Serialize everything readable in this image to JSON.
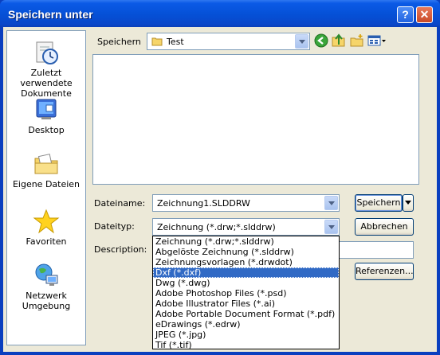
{
  "window": {
    "title": "Speichern unter"
  },
  "places": [
    {
      "label": "Zuletzt verwendete Dokumente",
      "icon": "recent-documents-icon"
    },
    {
      "label": "Desktop",
      "icon": "desktop-icon"
    },
    {
      "label": "Eigene Dateien",
      "icon": "my-documents-icon"
    },
    {
      "label": "Favoriten",
      "icon": "favorites-star-icon"
    },
    {
      "label": "Netzwerk Umgebung",
      "icon": "network-icon"
    }
  ],
  "location": {
    "label": "Speichern",
    "value": "Test"
  },
  "filename": {
    "label": "Dateiname:",
    "value": "Zeichnung1.SLDDRW"
  },
  "filetype": {
    "label": "Dateityp:",
    "value": "Zeichnung (*.drw;*.slddrw)",
    "options": [
      "Zeichnung (*.drw;*.slddrw)",
      "Abgelöste Zeichnung (*.slddrw)",
      "Zeichnungsvorlagen (*.drwdot)",
      "Dxf (*.dxf)",
      "Dwg (*.dwg)",
      "Adobe Photoshop Files (*.psd)",
      "Adobe Illustrator Files (*.ai)",
      "Adobe Portable Document Format (*.pdf)",
      "eDrawings (*.edrw)",
      "JPEG (*.jpg)",
      "Tif (*.tif)"
    ],
    "selected_index": 3
  },
  "description": {
    "label": "Description:"
  },
  "buttons": {
    "save": "Speichern",
    "cancel": "Abbrechen",
    "references": "Referenzen..."
  }
}
